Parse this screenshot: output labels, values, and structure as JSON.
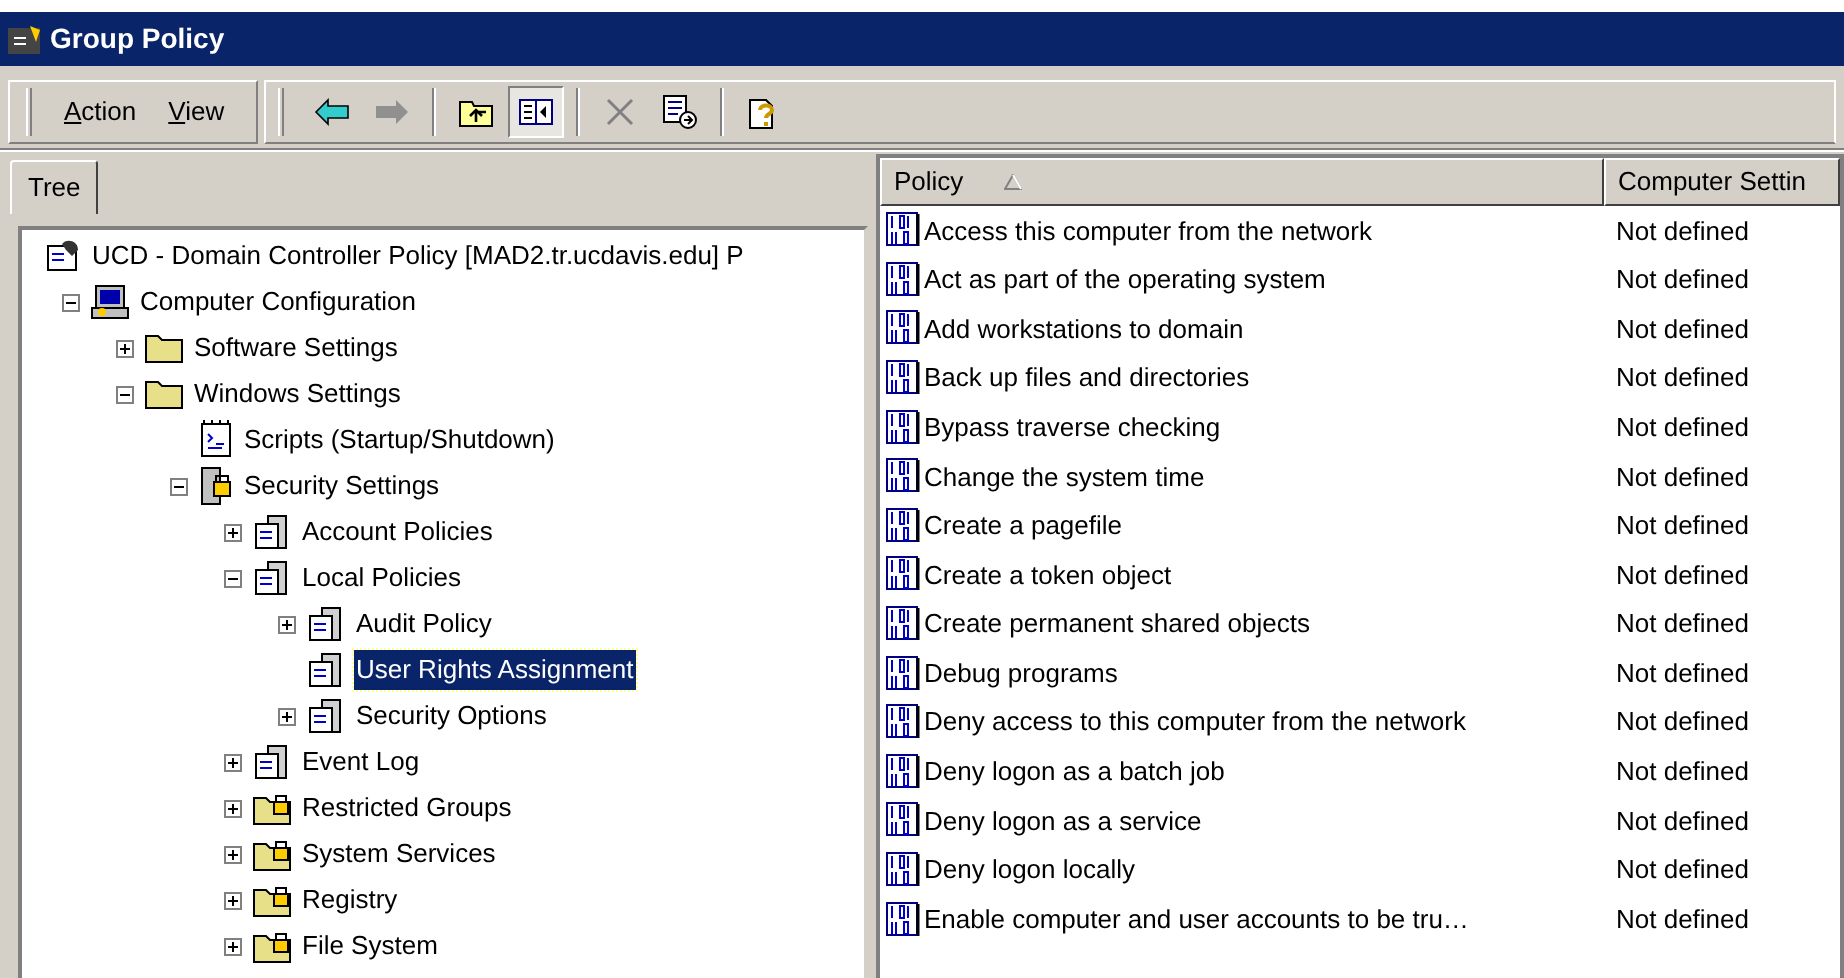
{
  "window": {
    "title": "Group Policy"
  },
  "menu": [
    {
      "label": "Action"
    },
    {
      "label": "View"
    }
  ],
  "toolbar": [
    {
      "kind": "back",
      "disabled": false,
      "pressed": false
    },
    {
      "kind": "forward",
      "disabled": true,
      "pressed": false
    },
    {
      "kind": "up",
      "disabled": false,
      "pressed": false
    },
    {
      "kind": "tree",
      "disabled": false,
      "pressed": true
    },
    {
      "kind": "delete",
      "disabled": true,
      "pressed": false
    },
    {
      "kind": "export",
      "disabled": false,
      "pressed": false
    },
    {
      "kind": "help",
      "disabled": false,
      "pressed": false
    }
  ],
  "tab": {
    "label": "Tree"
  },
  "tree": [
    {
      "label": "UCD - Domain Controller Policy [MAD2.tr.ucdavis.edu] P",
      "kind": "root",
      "selected": false,
      "children": [
        {
          "label": "Computer Configuration",
          "kind": "computer",
          "expanded": true,
          "selected": false,
          "children": [
            {
              "label": "Software Settings",
              "kind": "folder",
              "expanded": false,
              "selected": false
            },
            {
              "label": "Windows Settings",
              "kind": "folder",
              "expanded": true,
              "selected": false,
              "children": [
                {
                  "label": "Scripts (Startup/Shutdown)",
                  "kind": "script",
                  "selected": false
                },
                {
                  "label": "Security Settings",
                  "kind": "security",
                  "expanded": true,
                  "selected": false,
                  "children": [
                    {
                      "label": "Account Policies",
                      "kind": "policy",
                      "expanded": false,
                      "selected": false
                    },
                    {
                      "label": "Local Policies",
                      "kind": "policy",
                      "expanded": true,
                      "selected": false,
                      "children": [
                        {
                          "label": "Audit Policy",
                          "kind": "policy",
                          "expanded": false,
                          "selected": false
                        },
                        {
                          "label": "User Rights Assignment",
                          "kind": "policy",
                          "selected": true
                        },
                        {
                          "label": "Security Options",
                          "kind": "policy",
                          "expanded": false,
                          "selected": false
                        }
                      ]
                    },
                    {
                      "label": "Event Log",
                      "kind": "policy",
                      "expanded": false,
                      "selected": false
                    },
                    {
                      "label": "Restricted Groups",
                      "kind": "locked-folder",
                      "expanded": false,
                      "selected": false
                    },
                    {
                      "label": "System Services",
                      "kind": "locked-folder",
                      "expanded": false,
                      "selected": false
                    },
                    {
                      "label": "Registry",
                      "kind": "locked-folder",
                      "expanded": false,
                      "selected": false
                    },
                    {
                      "label": "File System",
                      "kind": "locked-folder",
                      "expanded": false,
                      "selected": false
                    }
                  ]
                }
              ]
            }
          ]
        }
      ]
    }
  ],
  "table": {
    "columns": [
      {
        "label": "Policy",
        "sorted": true
      },
      {
        "label": "Computer Settin",
        "sorted": false
      }
    ],
    "rows": [
      {
        "policy": "Access this computer from the network",
        "setting": "Not defined"
      },
      {
        "policy": "Act as part of the operating system",
        "setting": "Not defined"
      },
      {
        "policy": "Add workstations to domain",
        "setting": "Not defined"
      },
      {
        "policy": "Back up files and directories",
        "setting": "Not defined"
      },
      {
        "policy": "Bypass traverse checking",
        "setting": "Not defined"
      },
      {
        "policy": "Change the system time",
        "setting": "Not defined"
      },
      {
        "policy": "Create a pagefile",
        "setting": "Not defined"
      },
      {
        "policy": "Create a token object",
        "setting": "Not defined"
      },
      {
        "policy": "Create permanent shared objects",
        "setting": "Not defined"
      },
      {
        "policy": "Debug programs",
        "setting": "Not defined"
      },
      {
        "policy": "Deny access to this computer from the network",
        "setting": "Not defined"
      },
      {
        "policy": "Deny logon as a batch job",
        "setting": "Not defined"
      },
      {
        "policy": "Deny logon as a service",
        "setting": "Not defined"
      },
      {
        "policy": "Deny logon locally",
        "setting": "Not defined"
      },
      {
        "policy": "Enable computer and user accounts to be tru…",
        "setting": "Not defined"
      }
    ]
  }
}
